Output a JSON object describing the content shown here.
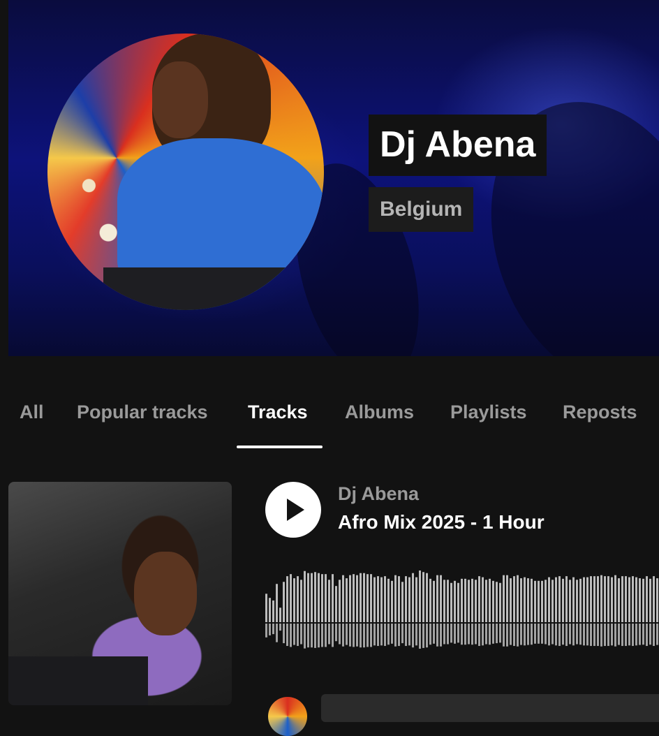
{
  "profile": {
    "name": "Dj Abena",
    "country": "Belgium"
  },
  "tabs": [
    {
      "label": "All",
      "active": false
    },
    {
      "label": "Popular tracks",
      "active": false
    },
    {
      "label": "Tracks",
      "active": true
    },
    {
      "label": "Albums",
      "active": false
    },
    {
      "label": "Playlists",
      "active": false
    },
    {
      "label": "Reposts",
      "active": false
    }
  ],
  "track": {
    "artist": "Dj Abena",
    "title": "Afro Mix 2025 - 1 Hour",
    "play_icon": "play-icon",
    "waveform_levels": [
      0.55,
      0.47,
      0.42,
      0.74,
      0.28,
      0.78,
      0.89,
      0.93,
      0.85,
      0.89,
      0.82,
      0.99,
      0.95,
      0.95,
      0.97,
      0.95,
      0.93,
      0.93,
      0.82,
      0.93,
      0.7,
      0.82,
      0.91,
      0.85,
      0.91,
      0.93,
      0.91,
      0.95,
      0.95,
      0.93,
      0.93,
      0.87,
      0.89,
      0.87,
      0.89,
      0.84,
      0.8,
      0.91,
      0.89,
      0.78,
      0.89,
      0.87,
      0.95,
      0.87,
      1.0,
      0.97,
      0.95,
      0.84,
      0.8,
      0.91,
      0.91,
      0.82,
      0.82,
      0.76,
      0.8,
      0.76,
      0.84,
      0.84,
      0.82,
      0.84,
      0.82,
      0.89,
      0.87,
      0.82,
      0.84,
      0.8,
      0.78,
      0.76,
      0.91,
      0.91,
      0.85,
      0.89,
      0.91,
      0.85,
      0.87,
      0.85,
      0.84,
      0.8,
      0.8,
      0.8,
      0.82,
      0.87,
      0.82,
      0.87,
      0.89,
      0.84,
      0.89,
      0.82,
      0.87,
      0.82,
      0.84,
      0.87,
      0.87,
      0.89,
      0.89,
      0.89,
      0.91,
      0.89,
      0.89,
      0.87,
      0.91,
      0.85,
      0.89,
      0.89,
      0.87,
      0.89,
      0.87,
      0.85,
      0.84,
      0.89,
      0.84,
      0.89,
      0.85,
      0.82,
      0.91
    ],
    "waveform_color": "#bdbdbd"
  },
  "colors": {
    "background": "#121212",
    "text_primary": "#ffffff",
    "text_muted": "#9a9a9a"
  }
}
